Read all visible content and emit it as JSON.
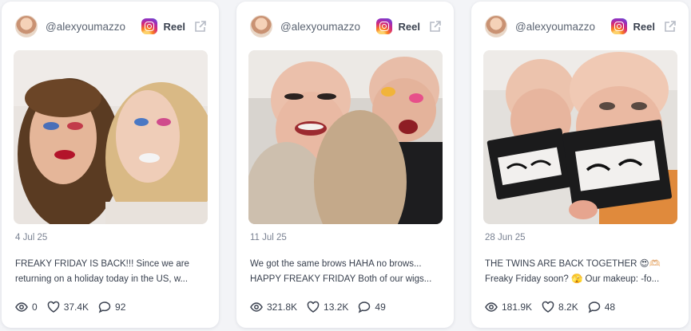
{
  "cards": [
    {
      "handle": "@alexyoumazzo",
      "platform_icon": "instagram-icon",
      "type": "Reel",
      "date": "4 Jul 25",
      "caption_line1": "FREAKY FRIDAY IS BACK!!! Since we are",
      "caption_line2": "returning on a holiday today in the US, w...",
      "views": "0",
      "likes": "37.4K",
      "comments": "92"
    },
    {
      "handle": "@alexyoumazzo",
      "platform_icon": "instagram-icon",
      "type": "Reel",
      "date": "11 Jul 25",
      "caption_line1": "We got the same brows HAHA no brows...",
      "caption_line2": "HAPPY FREAKY FRIDAY Both of our wigs...",
      "views": "321.8K",
      "likes": "13.2K",
      "comments": "49"
    },
    {
      "handle": "@alexyoumazzo",
      "platform_icon": "instagram-icon",
      "type": "Reel",
      "date": "28 Jun 25",
      "caption_line1": "THE TWINS ARE BACK TOGETHER 😍🫶🏻",
      "caption_line2": "Freaky Friday soon? 🫣 Our makeup: -fo...",
      "views": "181.9K",
      "likes": "8.2K",
      "comments": "48"
    }
  ],
  "colors": {
    "page_bg": "#f3f4f7",
    "card_bg": "#ffffff",
    "text": "#39414f",
    "muted": "#7a8292"
  }
}
